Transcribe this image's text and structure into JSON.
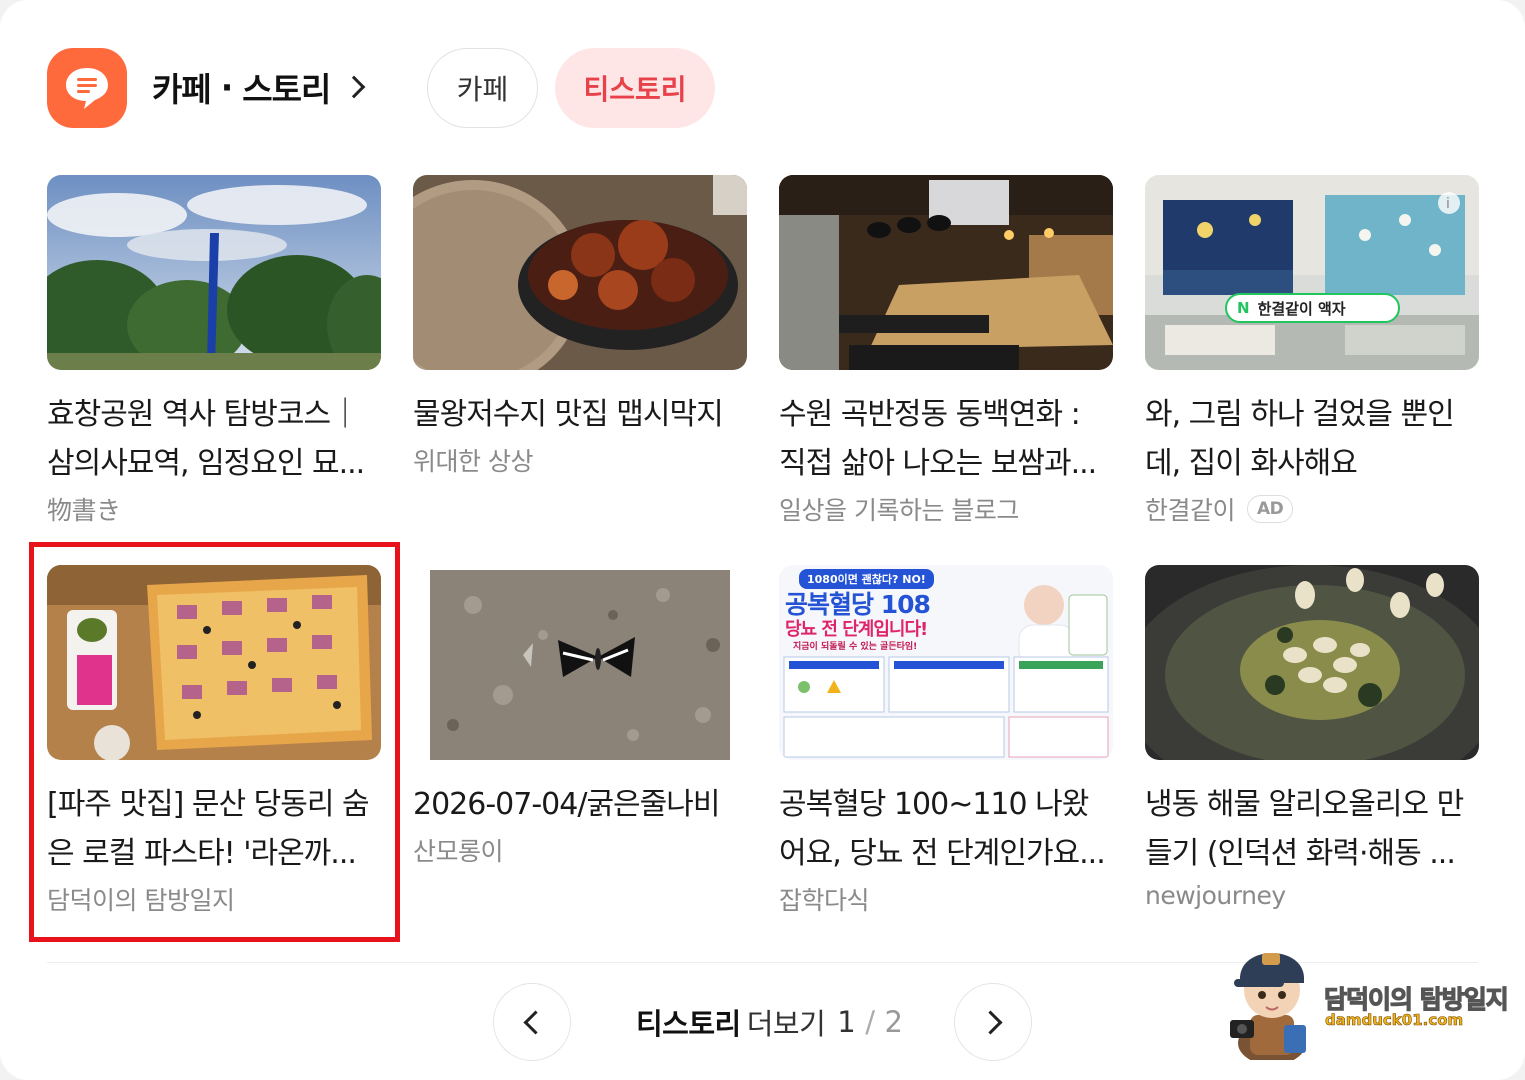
{
  "header": {
    "title_left": "카페",
    "title_dot": "·",
    "title_right": "스토리",
    "tabs": [
      "카페",
      "티스토리"
    ],
    "active_tab": "티스토리"
  },
  "cards": [
    {
      "title": "효창공원 역사 탐방코스｜삼의사묘역, 임정요인 묘...",
      "source": "物書き"
    },
    {
      "title": "물왕저수지 맛집 맵시막지",
      "source": "위대한 상상"
    },
    {
      "title": "수원 곡반정동 동백연화 : 직접 삶아 나오는 보쌈과...",
      "source": "일상을 기록하는 블로그"
    },
    {
      "title": "와, 그림 하나 걸었을 뿐인데, 집이 화사해요",
      "source": "한결같이",
      "badge": "AD",
      "ad_overlay": "한결같이 액자"
    },
    {
      "title": "[파주 맛집] 문산 당동리 숨은 로컬 파스타! '라온까...",
      "source": "담덕이의 탐방일지"
    },
    {
      "title": "2026-07-04/굵은줄나비",
      "source": "산모롱이"
    },
    {
      "title": "공복혈당 100~110 나왔어요, 당뇨 전 단계인가요...",
      "source": "잡학다식",
      "thumb_text": {
        "tag": "1080이면 괜찮다? NO!",
        "headline": "공복혈당 108",
        "sub": "당뇨 전 단계입니다!",
        "note": "지금이 되돌릴 수 있는 골든타임!"
      }
    },
    {
      "title": "냉동 해물 알리오올리오 만들기 (인덕션 화력·해동 ...",
      "source": "newjourney"
    }
  ],
  "pager": {
    "label_bold": "티스토리",
    "label_more": "더보기",
    "current": "1",
    "separator": "/",
    "total": "2"
  },
  "watermark": {
    "name": "담덕이의 탐방일지",
    "url": "damduck01.com"
  },
  "colors": {
    "brand_orange": "#ff6a3d",
    "active_tab_text": "#e8414a",
    "active_tab_bg": "#ffe6e6",
    "highlight_border": "#e8121a"
  }
}
